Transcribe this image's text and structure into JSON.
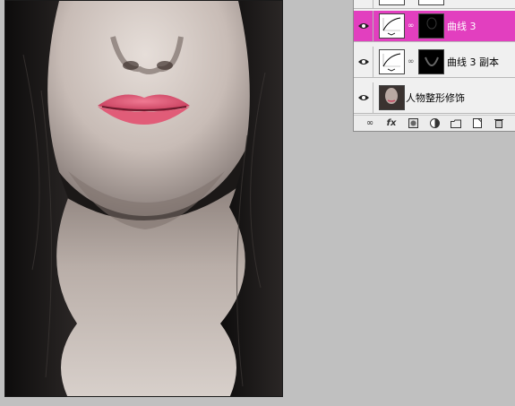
{
  "layers_panel": {
    "layers": [
      {
        "name": "",
        "selected": false,
        "has_mask": true
      },
      {
        "name": "曲线 3",
        "selected": true,
        "has_mask": true
      },
      {
        "name": "曲线 3 副本",
        "selected": false,
        "has_mask": true
      },
      {
        "name": "人物整形修饰",
        "selected": false,
        "has_mask": false
      }
    ],
    "toolbar_icons": [
      "link-icon",
      "fx-icon",
      "add-mask-icon",
      "adjustment-layer-icon",
      "new-group-icon",
      "new-layer-icon",
      "trash-icon"
    ],
    "fx_label": "fx"
  },
  "colors": {
    "selection": "#e23fbf",
    "lips": "#d84a68",
    "background": "#c0c0c0"
  }
}
